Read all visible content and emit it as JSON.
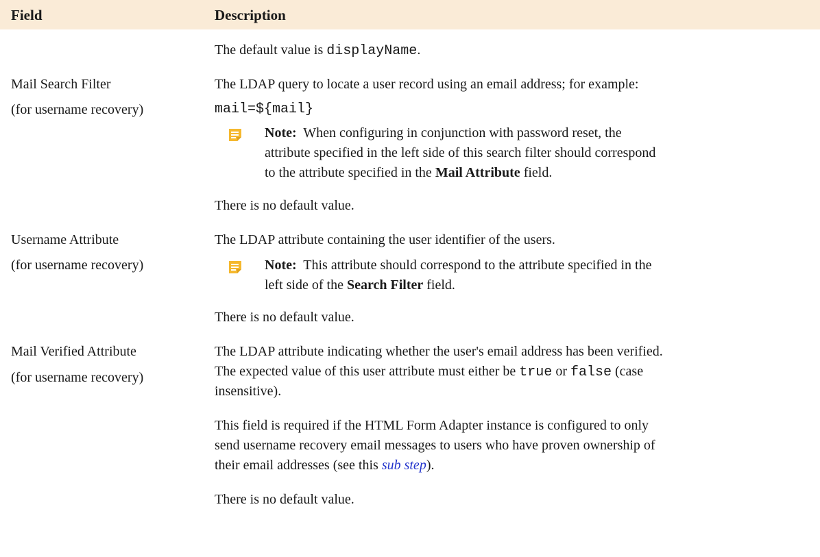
{
  "header": {
    "field": "Field",
    "description": "Description"
  },
  "row0": {
    "default_pre": "The default value is ",
    "default_code": "displayName",
    "default_post": "."
  },
  "row1": {
    "field": "Mail Search Filter",
    "qualifier": "(for username recovery)",
    "desc": "The LDAP query to locate a user record using an email address; for example:",
    "code": "mail=${mail}",
    "note": {
      "label": "Note:",
      "line1": "When configuring in conjunction with password reset, the",
      "line2": "attribute specified in the left side of this search filter should correspond",
      "line3_pre": "to the attribute specified in the ",
      "line3_bold": "Mail Attribute",
      "line3_post": " field."
    },
    "default": "There is no default value."
  },
  "row2": {
    "field": "Username Attribute",
    "qualifier": "(for username recovery)",
    "desc": "The LDAP attribute containing the user identifier of the users.",
    "note": {
      "label": "Note:",
      "line1": "This attribute should correspond to the attribute specified in the",
      "line2_pre": "left side of the ",
      "line2_bold": "Search Filter",
      "line2_post": " field."
    },
    "default": "There is no default value."
  },
  "row3": {
    "field": "Mail Verified Attribute",
    "qualifier": "(for username recovery)",
    "desc_line1": "The LDAP attribute indicating whether the user's email address has been verified.",
    "desc_line2_pre": "The expected value of this user attribute must either be ",
    "code_true": "true",
    "desc_line2_mid": " or ",
    "code_false": "false",
    "desc_line2_post": " (case",
    "desc_line3": "insensitive).",
    "para_line1": "This field is required if the HTML Form Adapter instance is configured to only",
    "para_line2": "send username recovery email messages to users who have proven ownership of",
    "para_line3_pre": "their email addresses (see this ",
    "para_link": "sub step",
    "para_line3_post": ").",
    "default": "There is no default value."
  },
  "icon_color": "#f5b82e"
}
